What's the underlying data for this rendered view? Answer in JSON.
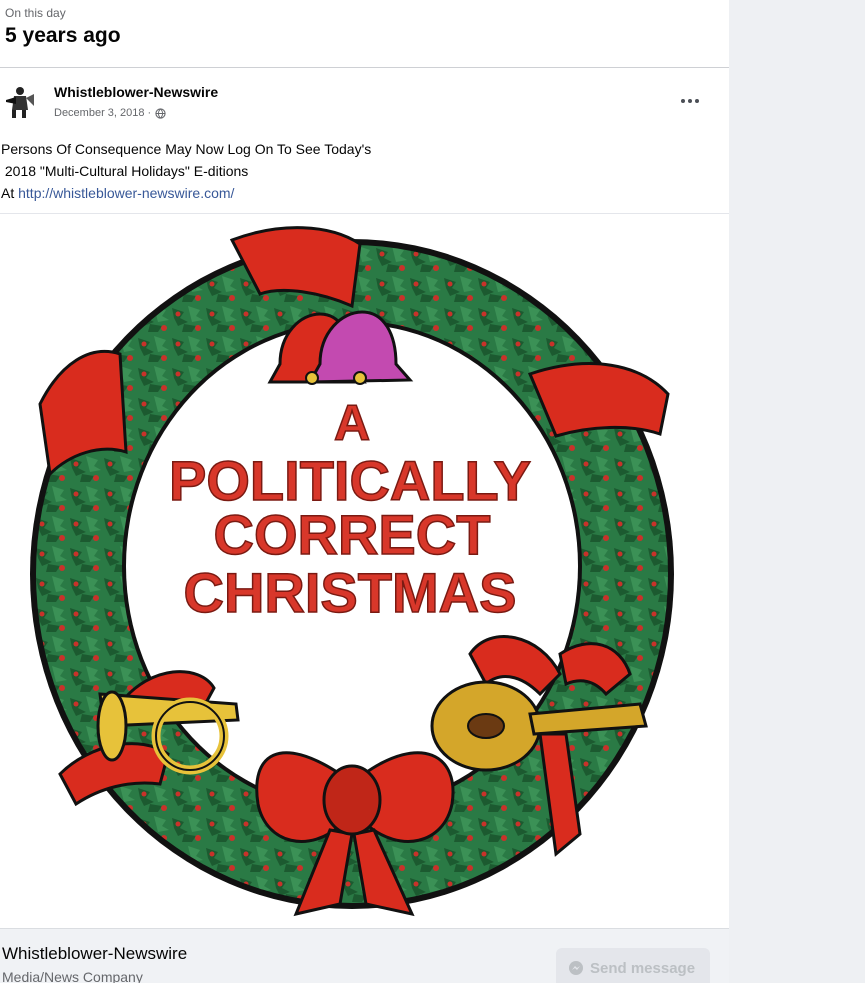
{
  "on_this_day": {
    "label": "On this day",
    "title": "5 years ago"
  },
  "post": {
    "author": "Whistleblower-Newswire",
    "date": "December 3, 2018 ·",
    "audience_icon": "globe-icon",
    "more_icon": "more-options-icon",
    "text_line1": "Persons Of Consequence May Now Log On To See Today's",
    "text_line2": " 2018 \"Multi-Cultural Holidays\" E-ditions",
    "text_prefix": "At ",
    "link": "http://whistleblower-newswire.com/"
  },
  "image": {
    "line1": "A",
    "line2": "POLITICALLY",
    "line3": "CORRECT",
    "line4": "CHRISTMAS",
    "colors": {
      "wreath": "#1f6b3a",
      "ribbon": "#d92c1e",
      "text": "#d8372a",
      "gold": "#e7c23a"
    }
  },
  "footer": {
    "page_name": "Whistleblower-Newswire",
    "category": "Media/News Company",
    "send_label": "Send message",
    "send_icon": "messenger-icon"
  }
}
